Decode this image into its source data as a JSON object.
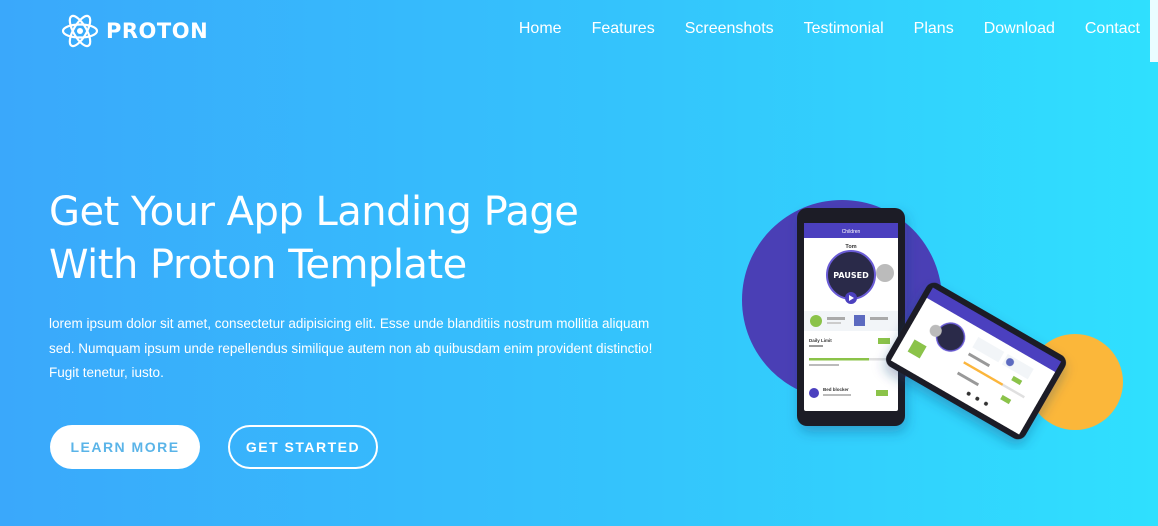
{
  "brand": {
    "name": "PROTON",
    "icon": "atom-logo-icon"
  },
  "nav": {
    "items": [
      {
        "label": "Home"
      },
      {
        "label": "Features"
      },
      {
        "label": "Screenshots"
      },
      {
        "label": "Testimonial"
      },
      {
        "label": "Plans"
      },
      {
        "label": "Download"
      },
      {
        "label": "Contact"
      }
    ]
  },
  "hero": {
    "title_line1": "Get Your App Landing Page",
    "title_line2": "With Proton Template",
    "description_line1": "lorem ipsum dolor sit amet, consectetur adipisicing elit. Esse unde blanditiis nostrum mollitia aliquam",
    "description_line2": "sed. Numquam ipsum unde repellendus similique autem non ab quibusdam enim provident distinctio!",
    "description_line3": "Fugit tenetur, iusto.",
    "learn_more_label": "LEARN MORE",
    "get_started_label": "GET STARTED"
  },
  "phone_app": {
    "header": "Children",
    "child_name": "Tom",
    "status": "PAUSED",
    "daily_limit_label": "Daily Limit",
    "bed_blocker_label": "Bed blocker"
  },
  "colors": {
    "gradient_start": "#3aa8fb",
    "gradient_end": "#2fe0fe",
    "learn_more_text": "#5ab4e8",
    "purple_circle": "#4a3fb5",
    "orange_circle": "#fbb73a",
    "app_header": "#4c3fbf"
  }
}
